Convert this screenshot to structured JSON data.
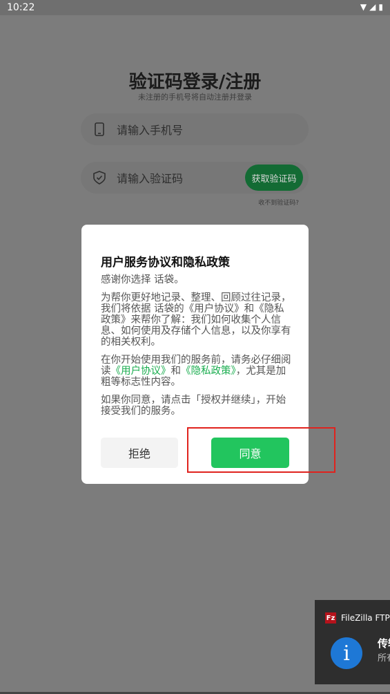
{
  "statusbar": {
    "time": "10:22",
    "wifi_icon": "wifi-icon",
    "signal_icon": "signal-icon",
    "battery_icon": "battery-icon"
  },
  "login": {
    "title": "验证码登录/注册",
    "subtitle": "未注册的手机号将自动注册并登录",
    "phone_placeholder": "请输入手机号",
    "code_placeholder": "请输入验证码",
    "get_code_label": "获取验证码",
    "no_code_label": "收不到验证码?"
  },
  "dialog": {
    "title": "用户服务协议和隐私政策",
    "p1": "感谢你选择 话袋。",
    "p2": "为帮你更好地记录、整理、回顾过往记录，我们将依据 话袋的《用户协议》和《隐私政策》来帮你了解：我们如何收集个人信息、如何使用及存储个人信息，以及你享有的相关权利。",
    "p3_prefix": "在你开始使用我们的服务前，请务必仔细阅读",
    "p3_link1": "《用户协议》",
    "p3_and": "和",
    "p3_link2": "《隐私政策》",
    "p3_suffix": "，尤其是加粗等标志性内容。",
    "p4": "如果你同意，请点击「授权并继续」，开始接受我们的服务。",
    "reject_label": "拒绝",
    "agree_label": "同意",
    "link_color": "#1aad4f",
    "agree_color": "#22c55e"
  },
  "toast": {
    "app_name": "FileZilla FTP",
    "title": "传输",
    "subtitle": "所有"
  }
}
